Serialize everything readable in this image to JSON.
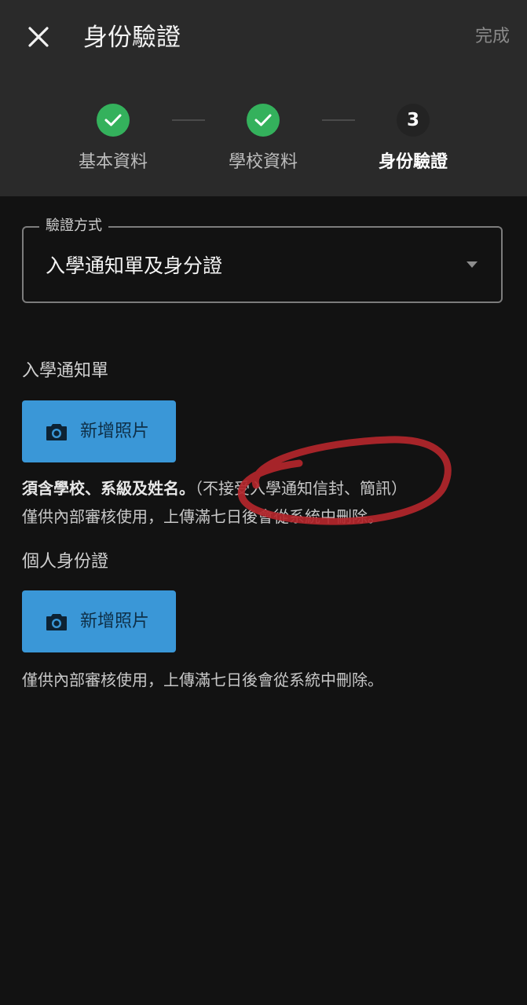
{
  "header": {
    "title": "身份驗證",
    "done_label": "完成"
  },
  "stepper": {
    "steps": [
      {
        "label": "基本資料",
        "state": "done"
      },
      {
        "label": "學校資料",
        "state": "done"
      },
      {
        "label": "身份驗證",
        "state": "current",
        "number": "3"
      }
    ]
  },
  "verification_method": {
    "legend": "驗證方式",
    "value": "入學通知單及身分證"
  },
  "admission_notice": {
    "label": "入學通知單",
    "button_label": "新增照片",
    "note_bold": "須含學校、系級及姓名。",
    "note_paren": "（不接受入學通知信封、簡訊）",
    "note_line2": "僅供內部審核使用，上傳滿七日後會從系統中刪除。"
  },
  "id_card": {
    "label": "個人身份證",
    "button_label": "新增照片",
    "note": "僅供內部審核使用，上傳滿七日後會從系統中刪除。"
  },
  "colors": {
    "header_bg": "#2a2a2a",
    "page_bg": "#121212",
    "done_green": "#34b15c",
    "button_blue": "#3a97d7",
    "annotation_red": "#b3262b"
  }
}
